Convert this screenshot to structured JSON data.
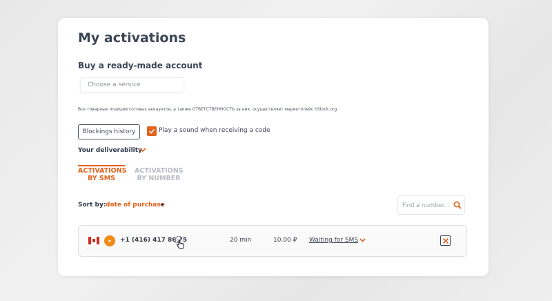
{
  "page": {
    "title": "My activations",
    "buy_section_title": "Buy a ready-made account",
    "service_placeholder": "Choose a service",
    "disclaimer": "Все товарные позиции готовых аккаунтов, а также ОТВЕТСТВЕННОСТЬ за них, осуществляет маркетплейс hStock.org"
  },
  "controls": {
    "blockings_history_label": "Blockings history",
    "play_sound_label": "Play a sound when receiving a code",
    "play_sound_checked": true,
    "deliverability_label": "Your deliverability"
  },
  "tabs": [
    {
      "line1": "ACTIVATIONS",
      "line2": "BY SMS",
      "active": true
    },
    {
      "line1": "ACTIVATIONS",
      "line2": "BY NUMBER",
      "active": false
    }
  ],
  "sort": {
    "label": "Sort by:",
    "value": "date of purchase"
  },
  "search": {
    "placeholder": "Find a number..."
  },
  "activations": [
    {
      "country_flag": "canada-flag",
      "service_icon": "service-logo",
      "phone": "+1 (416) 417 86 75",
      "time": "20 min",
      "price": "10.00 ₽",
      "status": "Waiting for SMS"
    }
  ],
  "colors": {
    "accent": "#e2621b",
    "text": "#2f3a4a",
    "muted": "#b7bcc3"
  }
}
